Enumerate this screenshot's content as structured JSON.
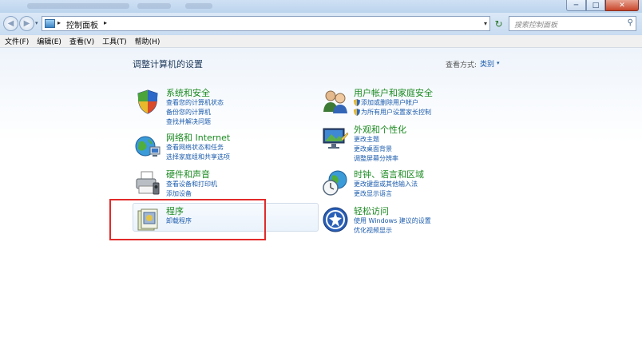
{
  "window": {
    "minimize_label": "─",
    "maximize_label": "□",
    "close_label": "✕"
  },
  "nav": {
    "back_icon": "back-arrow-icon",
    "forward_icon": "forward-arrow-icon",
    "address_segment": "控制面板",
    "address_separator": "▸",
    "address_dropdown": "▾",
    "refresh_glyph": "↻",
    "search_placeholder": "搜索控制面板",
    "search_glyph": "⚲"
  },
  "menubar": {
    "items": [
      "文件(F)",
      "编辑(E)",
      "查看(V)",
      "工具(T)",
      "帮助(H)"
    ]
  },
  "content": {
    "title": "调整计算机的设置",
    "view_by_label": "查看方式:",
    "view_by_value": "类别",
    "view_by_dropdown": "▾",
    "left": [
      {
        "title": "系统和安全",
        "links": [
          "查看您的计算机状态",
          "备份您的计算机",
          "查找并解决问题"
        ]
      },
      {
        "title": "网络和 Internet",
        "links": [
          "查看网络状态和任务",
          "选择家庭组和共享选项"
        ]
      },
      {
        "title": "硬件和声音",
        "links": [
          "查看设备和打印机",
          "添加设备"
        ]
      },
      {
        "title": "程序",
        "links": [
          "卸载程序"
        ]
      }
    ],
    "right": [
      {
        "title": "用户帐户和家庭安全",
        "links": [
          "添加或删除用户帐户",
          "为所有用户设置家长控制"
        ]
      },
      {
        "title": "外观和个性化",
        "links": [
          "更改主题",
          "更改桌面背景",
          "调整屏幕分辨率"
        ]
      },
      {
        "title": "时钟、语言和区域",
        "links": [
          "更改键盘或其他输入法",
          "更改显示语言"
        ]
      },
      {
        "title": "轻松访问",
        "links": [
          "使用 Windows 建议的设置",
          "优化视频显示"
        ]
      }
    ]
  }
}
